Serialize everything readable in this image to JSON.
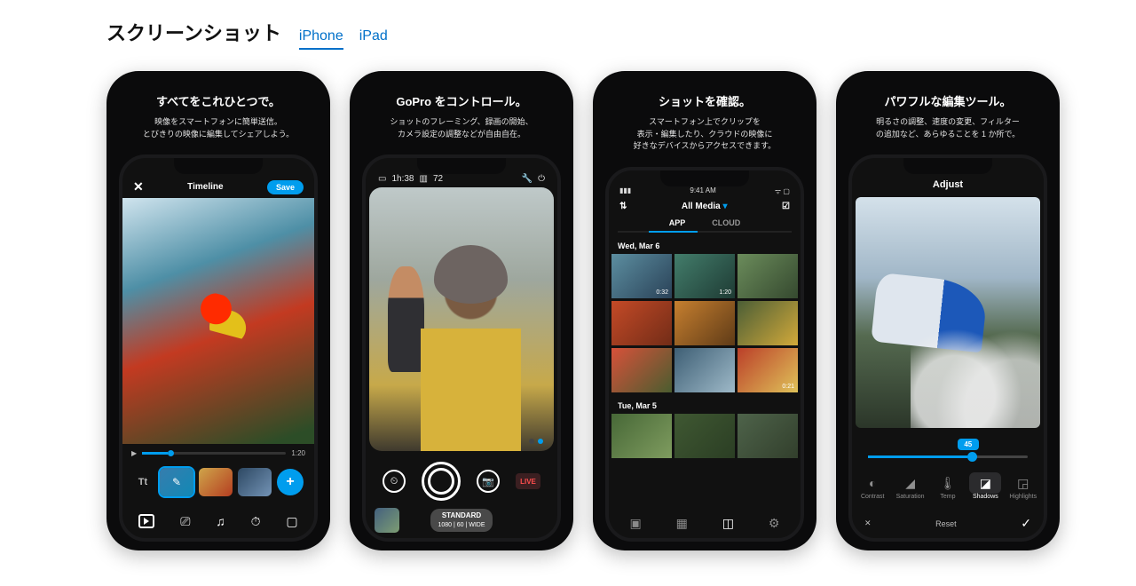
{
  "section_title": "スクリーンショット",
  "device_tabs": {
    "iphone": "iPhone",
    "ipad": "iPad"
  },
  "cards": [
    {
      "title": "すべてをこれひとつで。",
      "sub_l1": "映像をスマートフォンに簡単送信。",
      "sub_l2": "とびきりの映像に編集してシェアしよう。",
      "timeline": {
        "close": "✕",
        "label": "Timeline",
        "save": "Save",
        "duration": "1:20",
        "tt": "Tt",
        "add": "+"
      }
    },
    {
      "title": "GoPro をコントロール。",
      "sub_l1": "ショットのフレーミング、録画の開始、",
      "sub_l2": "カメラ設定の調整などが自由自在。",
      "camera": {
        "time": "1h:38",
        "batt": "72",
        "live": "LIVE",
        "mode_name": "STANDARD",
        "mode_spec": "1080 | 60 | WIDE"
      }
    },
    {
      "title": "ショットを確認。",
      "sub_l1": "スマートフォン上でクリップを",
      "sub_l2": "表示・編集したり、クラウドの映像に",
      "sub_l3": "好きなデバイスからアクセスできます。",
      "media": {
        "clock": "9:41 AM",
        "header": "All Media",
        "tab_app": "APP",
        "tab_cloud": "CLOUD",
        "date1": "Wed, Mar 6",
        "durations1": [
          "0:32",
          "1:20",
          "",
          "",
          "",
          "0:21"
        ],
        "date2": "Tue, Mar 5"
      }
    },
    {
      "title": "パワフルな編集ツール。",
      "sub_l1": "明るさの調整、速度の変更、フィルター",
      "sub_l2": "の追加など、あらゆることを 1 か所で。",
      "adjust": {
        "header": "Adjust",
        "value": "45",
        "dials": [
          "Contrast",
          "Saturation",
          "Temp",
          "Shadows",
          "Highlights"
        ],
        "close": "✕",
        "reset": "Reset",
        "check": "✓"
      }
    }
  ]
}
